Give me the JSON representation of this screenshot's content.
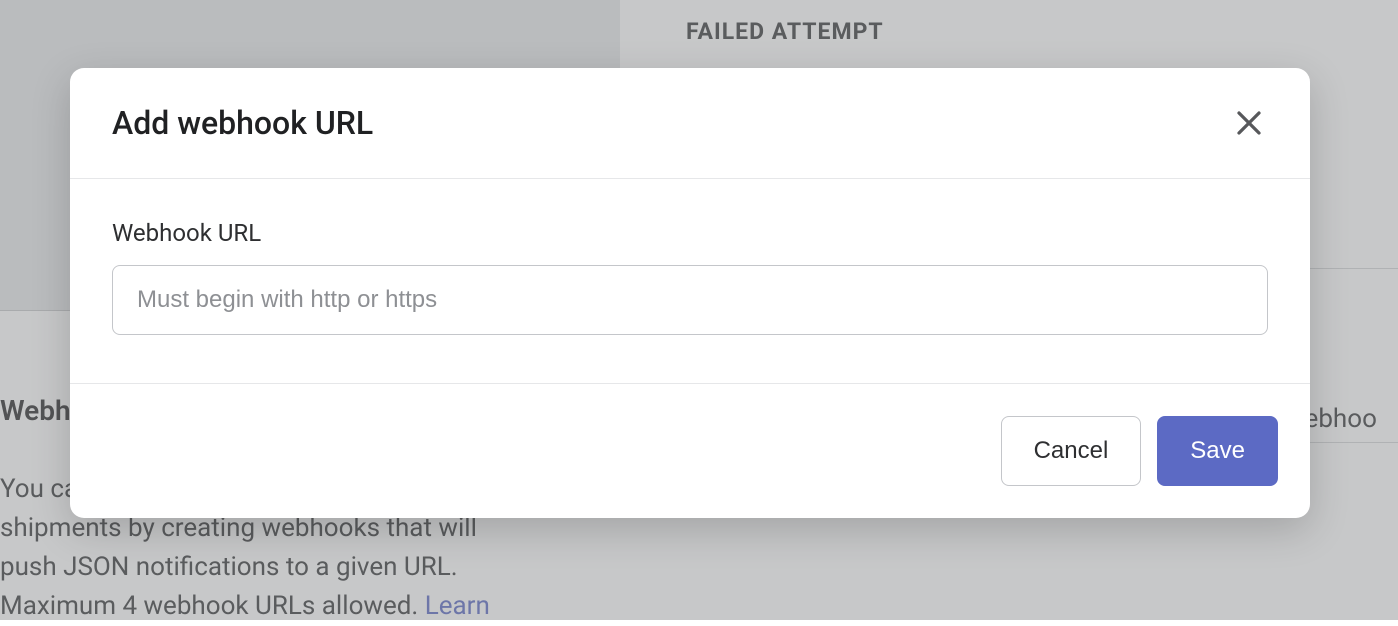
{
  "background": {
    "failed_attempt_label": "FAILED ATTEMPT",
    "section_heading": "Webh",
    "description_line1": "You ca",
    "description_line2": "shipments by creating webhooks that will",
    "description_line3": "push JSON notifications to a given URL.",
    "description_line4_prefix": "Maximum 4 webhook URLs allowed. ",
    "description_line4_link": "Learn",
    "right_fragment": "webhoo"
  },
  "modal": {
    "title": "Add webhook URL",
    "field_label": "Webhook URL",
    "input_placeholder": "Must begin with http or https",
    "input_value": "",
    "cancel_label": "Cancel",
    "save_label": "Save"
  }
}
